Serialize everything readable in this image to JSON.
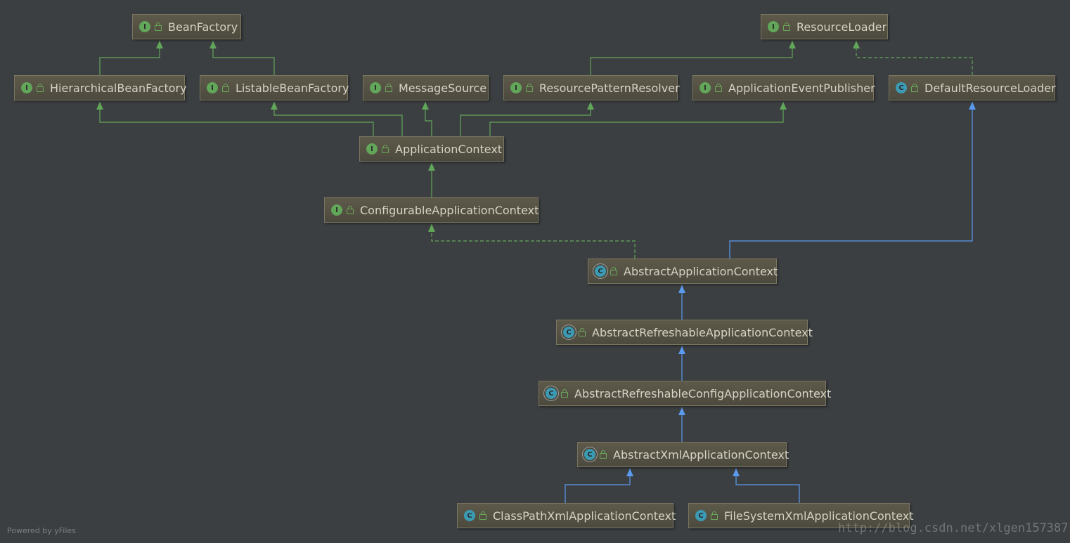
{
  "diagram": {
    "nodes": [
      {
        "id": "bf",
        "label": "BeanFactory",
        "kind": "I"
      },
      {
        "id": "rl",
        "label": "ResourceLoader",
        "kind": "I"
      },
      {
        "id": "hbf",
        "label": "HierarchicalBeanFactory",
        "kind": "I"
      },
      {
        "id": "lbf",
        "label": "ListableBeanFactory",
        "kind": "I"
      },
      {
        "id": "ms",
        "label": "MessageSource",
        "kind": "I"
      },
      {
        "id": "rpr",
        "label": "ResourcePatternResolver",
        "kind": "I"
      },
      {
        "id": "aep",
        "label": "ApplicationEventPublisher",
        "kind": "I"
      },
      {
        "id": "drl",
        "label": "DefaultResourceLoader",
        "kind": "C"
      },
      {
        "id": "ac",
        "label": "ApplicationContext",
        "kind": "I"
      },
      {
        "id": "cac",
        "label": "ConfigurableApplicationContext",
        "kind": "I"
      },
      {
        "id": "aac",
        "label": "AbstractApplicationContext",
        "kind": "AC"
      },
      {
        "id": "arac",
        "label": "AbstractRefreshableApplicationContext",
        "kind": "AC"
      },
      {
        "id": "arcac",
        "label": "AbstractRefreshableConfigApplicationContext",
        "kind": "AC"
      },
      {
        "id": "axac",
        "label": "AbstractXmlApplicationContext",
        "kind": "AC"
      },
      {
        "id": "cpx",
        "label": "ClassPathXmlApplicationContext",
        "kind": "C"
      },
      {
        "id": "fsx",
        "label": "FileSystemXmlApplicationContext",
        "kind": "C"
      }
    ],
    "edges": [
      {
        "from": "hbf",
        "to": "bf",
        "type": "extends-interface"
      },
      {
        "from": "lbf",
        "to": "bf",
        "type": "extends-interface"
      },
      {
        "from": "rpr",
        "to": "rl",
        "type": "extends-interface"
      },
      {
        "from": "drl",
        "to": "rl",
        "type": "implements"
      },
      {
        "from": "ac",
        "to": "hbf",
        "type": "extends-interface"
      },
      {
        "from": "ac",
        "to": "lbf",
        "type": "extends-interface"
      },
      {
        "from": "ac",
        "to": "ms",
        "type": "extends-interface"
      },
      {
        "from": "ac",
        "to": "rpr",
        "type": "extends-interface"
      },
      {
        "from": "ac",
        "to": "aep",
        "type": "extends-interface"
      },
      {
        "from": "cac",
        "to": "ac",
        "type": "extends-interface"
      },
      {
        "from": "aac",
        "to": "cac",
        "type": "implements"
      },
      {
        "from": "aac",
        "to": "drl",
        "type": "extends-class"
      },
      {
        "from": "arac",
        "to": "aac",
        "type": "extends-class"
      },
      {
        "from": "arcac",
        "to": "arac",
        "type": "extends-class"
      },
      {
        "from": "axac",
        "to": "arcac",
        "type": "extends-class"
      },
      {
        "from": "cpx",
        "to": "axac",
        "type": "extends-class"
      },
      {
        "from": "fsx",
        "to": "axac",
        "type": "extends-class"
      }
    ],
    "colors": {
      "background": "#3c3f41",
      "interface_edge": "#62a65a",
      "class_edge": "#5b9bef",
      "implements_edge": "#62a65a"
    }
  },
  "badges": {
    "I": "I",
    "C": "C",
    "AC": "C"
  },
  "footer": "Powered by yFiles",
  "watermark": "http://blog.csdn.net/xlgen157387"
}
